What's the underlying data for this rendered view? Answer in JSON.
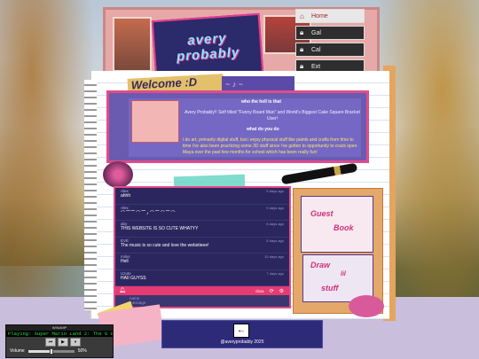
{
  "header": {
    "logo_line1": "avery",
    "logo_line2": "probably"
  },
  "nav": [
    {
      "label": "Home",
      "icon": "house-icon"
    },
    {
      "label": "Gal",
      "icon": "lock-icon"
    },
    {
      "label": "Cal",
      "icon": "lock-icon"
    },
    {
      "label": "Ext",
      "icon": "lock-icon"
    }
  ],
  "welcome": {
    "title": "Welcome :D",
    "deco": "~ ♪ ~"
  },
  "info": {
    "q1": "who the hell is that",
    "a1": "Avery Probably!! Self titled \"Funny Board Man\" and World's Biggest Cake Square Bracket User!",
    "q2": "what do you do",
    "a2": "i do art, primarily digital stuff, but i enjoy physical stuff like paints and crafts from time to time i've also been practicing some 3D stuff since i've gotten to opportunity to crack open Maya over the past few months for school which has been really fun!"
  },
  "chat": {
    "messages": [
      {
        "name": "Alex",
        "time": "5 days ago",
        "text": "ahhh"
      },
      {
        "name": "Alex",
        "time": "5 days ago",
        "text": "⌒ ⁀ ⁀ ⌒ ⁀ ♪ ⌒ ⁀ ⌒ ⁀ ⌒"
      },
      {
        "name": "aby",
        "time": "8 days ago",
        "text": "THIS WEBSITE IS SO CUTE WHATYY"
      },
      {
        "name": "EVE",
        "time": "8 days ago",
        "text": "The music is so cute and love the webstieee!"
      },
      {
        "name": "milos",
        "time": "10 days ago",
        "text": "Hell"
      },
      {
        "name": "Uzute",
        "time": "7 days ago",
        "text": "HAII GUYSS"
      }
    ],
    "bar_label": "cbox",
    "input_name": "name",
    "input_message": "message"
  },
  "guest": {
    "line1": "Guest",
    "line2": "Book",
    "line3": "Draw",
    "line4": "lil",
    "line5": "stuff"
  },
  "footer": {
    "back": "←",
    "copyright": "@averyprobably 2025"
  },
  "player": {
    "title_bar": "WINAMP",
    "now_playing": "Playing: Super Mario Land 2: The 6 Golden Coi",
    "prev": "⏮",
    "play": "▶",
    "pause": "⏸",
    "volume_label": "Volume",
    "volume_value": 0.5,
    "volume_pct": "50%"
  },
  "colors": {
    "accent_pink": "#e04c8b",
    "panel_purple": "#6a5ab0",
    "footer_navy": "#2d2a78"
  }
}
